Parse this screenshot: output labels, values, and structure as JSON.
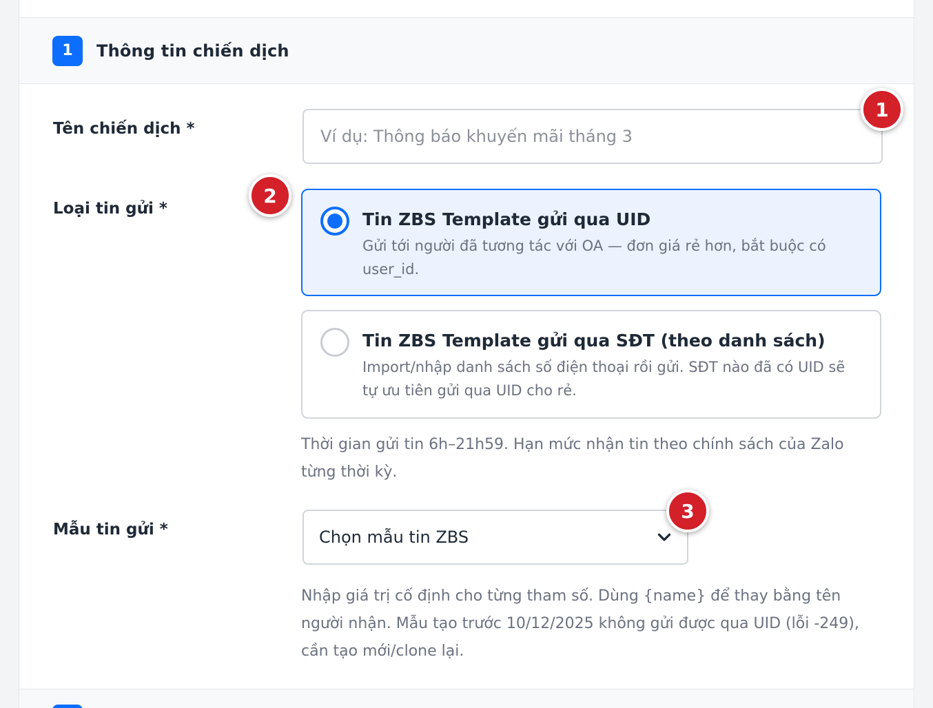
{
  "section": {
    "step_number": "1",
    "title": "Thông tin chiến dịch"
  },
  "campaign_name": {
    "label": "Tên chiến dịch *",
    "value": "",
    "placeholder": "Ví dụ: Thông báo khuyến mãi tháng 3"
  },
  "message_type": {
    "label": "Loại tin gửi *",
    "options": [
      {
        "title": "Tin ZBS Template gửi qua UID",
        "description": "Gửi tới người đã tương tác với OA — đơn giá rẻ hơn, bắt buộc có user_id.",
        "selected": true
      },
      {
        "title": "Tin ZBS Template gửi qua SĐT (theo danh sách)",
        "description": "Import/nhập danh sách số điện thoại rồi gửi. SĐT nào đã có UID sẽ tự ưu tiên gửi qua UID cho rẻ.",
        "selected": false
      }
    ],
    "help": "Thời gian gửi tin 6h–21h59. Hạn mức nhận tin theo chính sách của Zalo từng thời kỳ."
  },
  "template": {
    "label": "Mẫu tin gửi *",
    "selected_value": "Chọn mẫu tin ZBS",
    "help": "Nhập giá trị cố định cho từng tham số. Dùng {name} để thay bằng tên người nhận. Mẫu tạo trước 10/12/2025 không gửi được qua UID (lỗi -249), cần tạo mới/clone lại."
  },
  "markers": [
    "1",
    "2",
    "3"
  ],
  "icons": {
    "select_arrow": "chevron-down-icon"
  },
  "colors": {
    "accent": "#0d6efd",
    "marker": "#d32029",
    "selected_bg": "#ecf3fe"
  }
}
